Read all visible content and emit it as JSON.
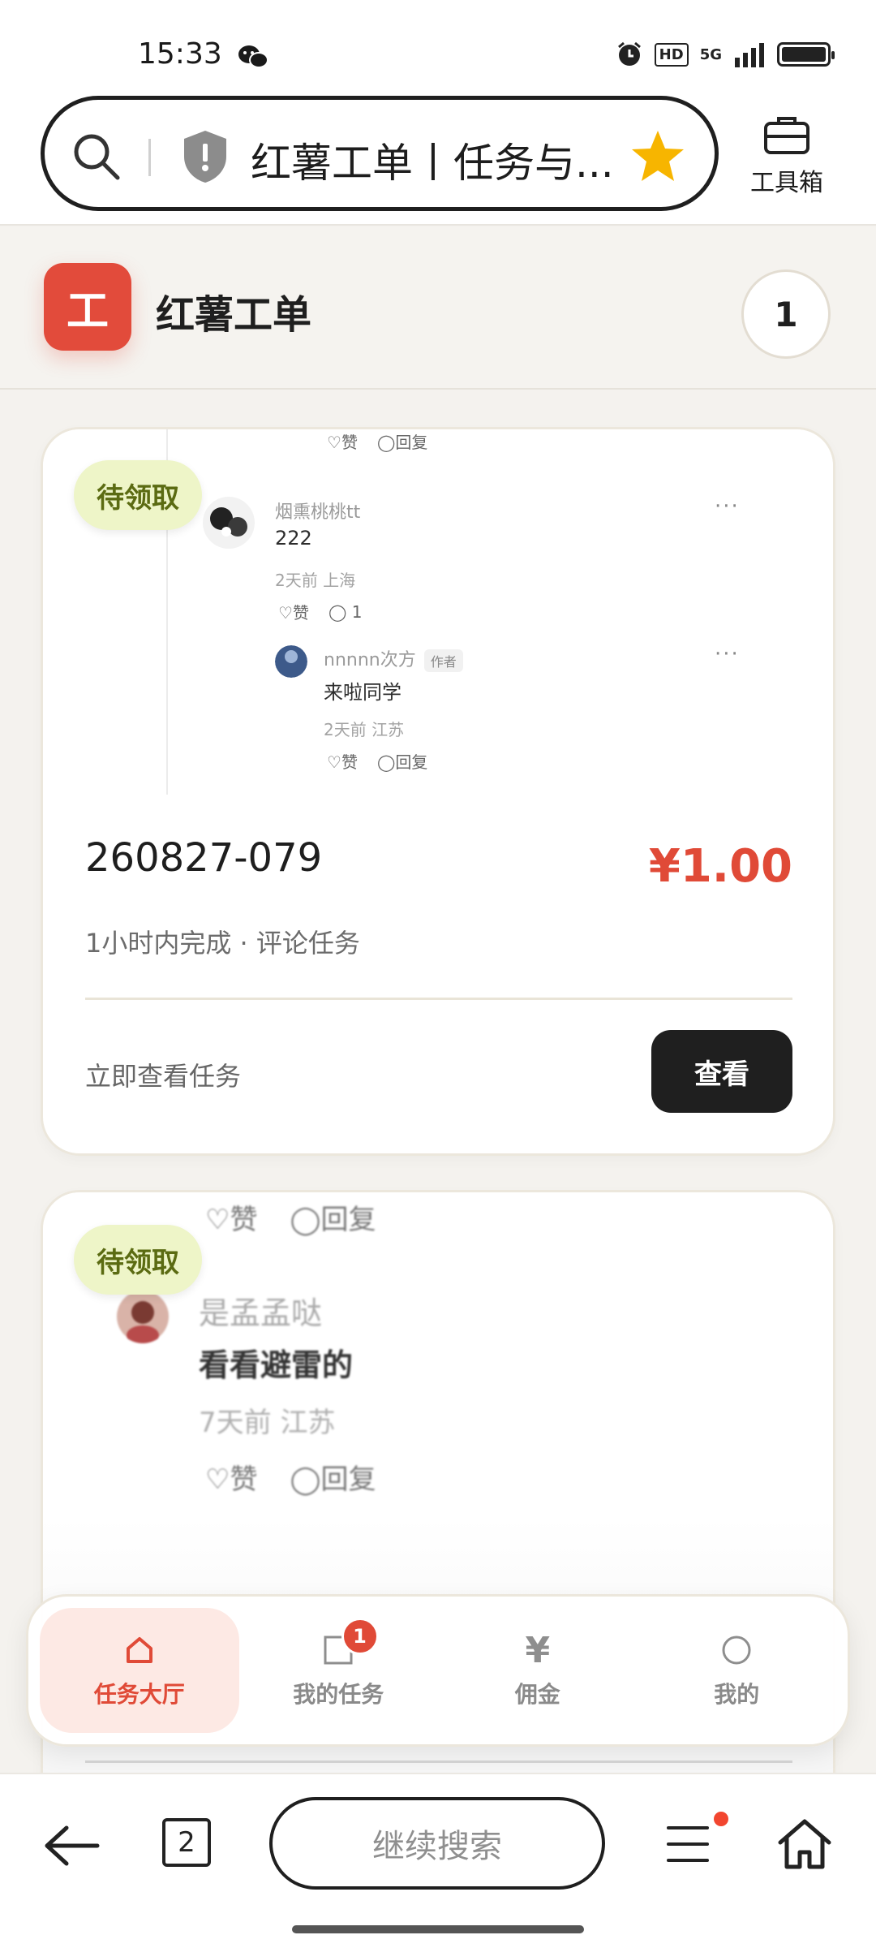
{
  "status_bar": {
    "time": "15:33",
    "network_badge": "HD",
    "signal_label": "5G",
    "icons": [
      "wechat-icon",
      "alarm-icon",
      "hd-icon",
      "signal-icon",
      "battery-icon"
    ]
  },
  "browser": {
    "page_title": "红薯工单丨任务与...",
    "toolbox_label": "工具箱",
    "search_button_label": "继续搜索",
    "tab_count": "2"
  },
  "app": {
    "logo_char": "工",
    "name": "红薯工单",
    "count": "1"
  },
  "tasks": [
    {
      "status": "待领取",
      "id": "260827-079",
      "price": "¥1.00",
      "subtitle": "1小时内完成 · 评论任务",
      "cta_text": "立即查看任务",
      "button_label": "查看",
      "preview": {
        "top_actions": [
          "赞",
          "回复"
        ],
        "comments": [
          {
            "name": "烟熏桃桃tt",
            "text": "222",
            "meta": "2天前 上海",
            "likes_label": "赞",
            "reply_count": "1"
          },
          {
            "name": "nnnnn次方",
            "tag": "作者",
            "text": "来啦同学",
            "meta": "2天前 江苏",
            "likes_label": "赞",
            "reply_label": "回复"
          }
        ]
      }
    },
    {
      "status": "待领取",
      "preview": {
        "top_actions": [
          "赞",
          "回复"
        ],
        "comment": {
          "name": "是孟孟哒",
          "text": "看看避雷的",
          "meta": "7天前 江苏",
          "likes_label": "赞",
          "reply_label": "回复"
        }
      }
    }
  ],
  "nav": {
    "items": [
      {
        "label": "任务大厅",
        "icon": "home-icon",
        "active": true
      },
      {
        "label": "我的任务",
        "icon": "square-icon",
        "badge": "1"
      },
      {
        "label": "佣金",
        "icon": "yen-icon"
      },
      {
        "label": "我的",
        "icon": "circle-icon"
      }
    ]
  },
  "colors": {
    "accent": "#e04a37",
    "pill_bg": "#eef5c8",
    "pill_text": "#5b6b12",
    "dark_button": "#1f1f1f"
  }
}
